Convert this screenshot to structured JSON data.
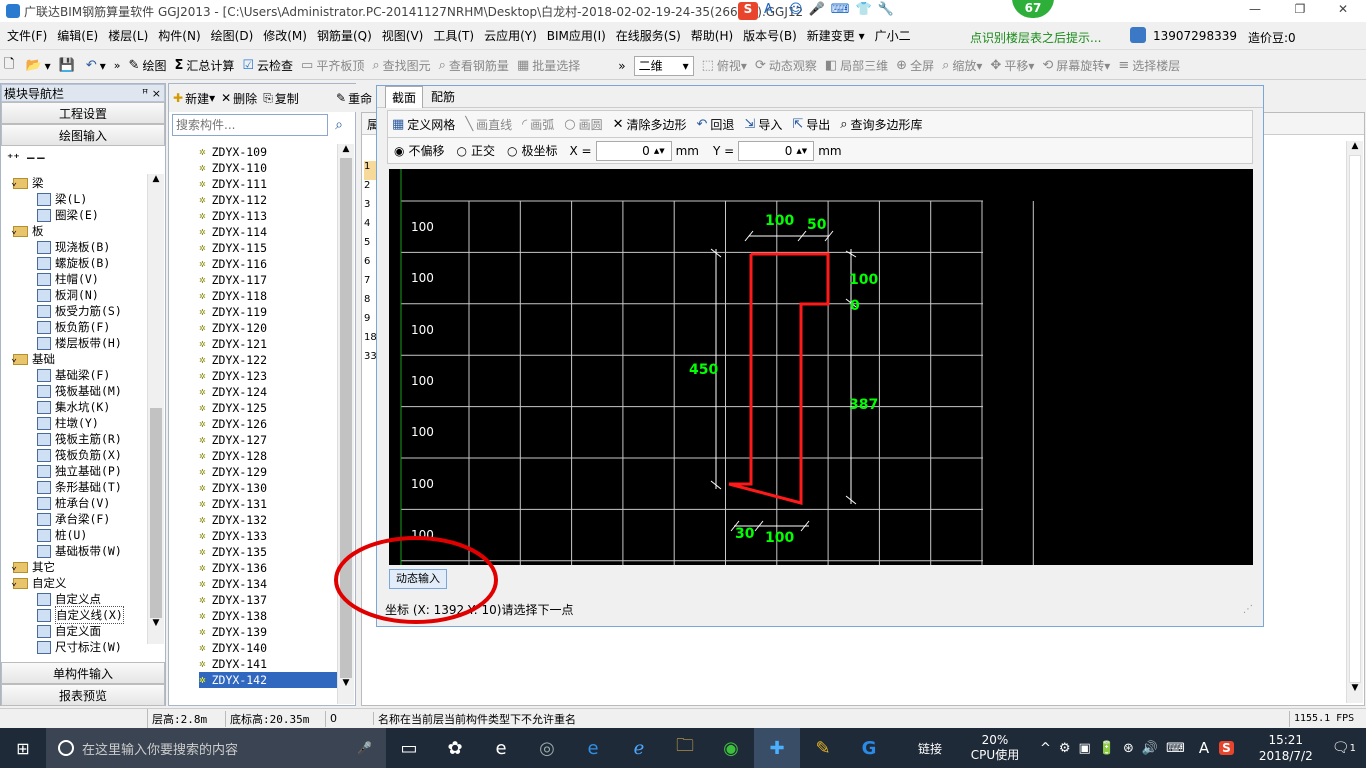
{
  "window": {
    "title": "广联达BIM钢筋算量软件 GGJ2013 - [C:\\Users\\Administrator.PC-20141127NRHM\\Desktop\\白龙村-2018-02-02-19-24-35(2666版).GGJ12]",
    "badge": "67",
    "min": "—",
    "restore": "❐",
    "close": "✕"
  },
  "menu": [
    "文件(F)",
    "编辑(E)",
    "楼层(L)",
    "构件(N)",
    "绘图(D)",
    "修改(M)",
    "钢筋量(Q)",
    "视图(V)",
    "工具(T)",
    "云应用(Y)",
    "BIM应用(I)",
    "在线服务(S)",
    "帮助(H)",
    "版本号(B)",
    "新建变更 ▾",
    "广小二"
  ],
  "menu_right": {
    "hint": "点识别楼层表之后提示...",
    "phone": "13907298339",
    "cost": "造价豆:0"
  },
  "toolbar": {
    "draw": "绘图",
    "sum": "汇总计算",
    "cloud": "云检查",
    "flat": "平齐板顶",
    "find": "查找图元",
    "view_rebar": "查看钢筋量",
    "batch": "批量选择",
    "mode2d": "二维",
    "top": "俯视",
    "dynamic": "动态观察",
    "local3d": "局部三维",
    "fullscreen": "全屏",
    "zoom": "缩放",
    "pan": "平移",
    "rotate": "屏幕旋转",
    "select_floor": "选择楼层"
  },
  "nav": {
    "title": "模块导航栏",
    "pin": "ꟸ ×",
    "project": "工程设置",
    "drawing_input": "绘图输入",
    "single_input": "单构件输入",
    "report": "报表预览"
  },
  "tree": [
    {
      "t": "梁",
      "lvl": 0,
      "folder": true
    },
    {
      "t": "梁(L)",
      "lvl": 1
    },
    {
      "t": "圈梁(E)",
      "lvl": 1
    },
    {
      "t": "板",
      "lvl": 0,
      "folder": true
    },
    {
      "t": "现浇板(B)",
      "lvl": 1
    },
    {
      "t": "螺旋板(B)",
      "lvl": 1
    },
    {
      "t": "柱帽(V)",
      "lvl": 1
    },
    {
      "t": "板洞(N)",
      "lvl": 1
    },
    {
      "t": "板受力筋(S)",
      "lvl": 1
    },
    {
      "t": "板负筋(F)",
      "lvl": 1
    },
    {
      "t": "楼层板带(H)",
      "lvl": 1
    },
    {
      "t": "基础",
      "lvl": 0,
      "folder": true
    },
    {
      "t": "基础梁(F)",
      "lvl": 1
    },
    {
      "t": "筏板基础(M)",
      "lvl": 1
    },
    {
      "t": "集水坑(K)",
      "lvl": 1
    },
    {
      "t": "柱墩(Y)",
      "lvl": 1
    },
    {
      "t": "筏板主筋(R)",
      "lvl": 1
    },
    {
      "t": "筏板负筋(X)",
      "lvl": 1
    },
    {
      "t": "独立基础(P)",
      "lvl": 1
    },
    {
      "t": "条形基础(T)",
      "lvl": 1
    },
    {
      "t": "桩承台(V)",
      "lvl": 1
    },
    {
      "t": "承台梁(F)",
      "lvl": 1
    },
    {
      "t": "桩(U)",
      "lvl": 1
    },
    {
      "t": "基础板带(W)",
      "lvl": 1
    },
    {
      "t": "其它",
      "lvl": 0,
      "folder": true
    },
    {
      "t": "自定义",
      "lvl": 0,
      "folder": true
    },
    {
      "t": "自定义点",
      "lvl": 1
    },
    {
      "t": "自定义线(X)",
      "lvl": 1,
      "sel": true
    },
    {
      "t": "自定义面",
      "lvl": 1
    },
    {
      "t": "尺寸标注(W)",
      "lvl": 1
    }
  ],
  "list": {
    "new": "新建",
    "delete": "删除",
    "copy": "复制",
    "rename": "重命",
    "search_placeholder": "搜索构件...",
    "items": [
      "ZDYX-109",
      "ZDYX-110",
      "ZDYX-111",
      "ZDYX-112",
      "ZDYX-113",
      "ZDYX-114",
      "ZDYX-115",
      "ZDYX-116",
      "ZDYX-117",
      "ZDYX-118",
      "ZDYX-119",
      "ZDYX-120",
      "ZDYX-121",
      "ZDYX-122",
      "ZDYX-123",
      "ZDYX-124",
      "ZDYX-125",
      "ZDYX-126",
      "ZDYX-127",
      "ZDYX-128",
      "ZDYX-129",
      "ZDYX-130",
      "ZDYX-131",
      "ZDYX-132",
      "ZDYX-133",
      "ZDYX-135",
      "ZDYX-136",
      "ZDYX-134",
      "ZDYX-137",
      "ZDYX-138",
      "ZDYX-139",
      "ZDYX-140",
      "ZDYX-141",
      "ZDYX-142"
    ]
  },
  "props": {
    "head": "属",
    "rows": [
      "1",
      "2",
      "3",
      "4",
      "5",
      "6",
      "7",
      "8",
      "9",
      "18",
      "33"
    ]
  },
  "dialog": {
    "tab1": "截面",
    "tab2": "配筋",
    "grid": "定义网格",
    "line": "画直线",
    "arc": "画弧",
    "circle": "画圆",
    "clear": "清除多边形",
    "undo": "回退",
    "import": "导入",
    "export": "导出",
    "query": "查询多边形库",
    "no_offset": "不偏移",
    "ortho": "正交",
    "polar": "极坐标",
    "x_label": "X =",
    "x_val": "0",
    "y_label": "Y =",
    "y_val": "0",
    "unit": "mm",
    "dyn_input": "动态输入",
    "status": "坐标 (X: 1392 Y: 10)请选择下一点",
    "grid_labels": [
      "100",
      "100",
      "100",
      "100",
      "100",
      "100",
      "100"
    ],
    "dims": [
      "100",
      "50",
      "100",
      "0",
      "450",
      "387",
      "30",
      "100"
    ]
  },
  "status": {
    "floor_h": "层高:2.8m",
    "base_h": "底标高:20.35m",
    "zero": "0",
    "msg": "名称在当前层当前构件类型下不允许重名",
    "fps": "1155.1 FPS"
  },
  "taskbar": {
    "search": "在这里输入你要搜索的内容",
    "link": "链接",
    "cpu": "20%",
    "cpu_label": "CPU使用",
    "ime": "A",
    "time": "15:21",
    "date": "2018/7/2",
    "notif": "1"
  },
  "colors": {
    "canvas": "#000000",
    "grid": "#c8c8c8",
    "shape": "#ff1a1a",
    "dim": "#00ff00",
    "annot": "#e00000"
  }
}
